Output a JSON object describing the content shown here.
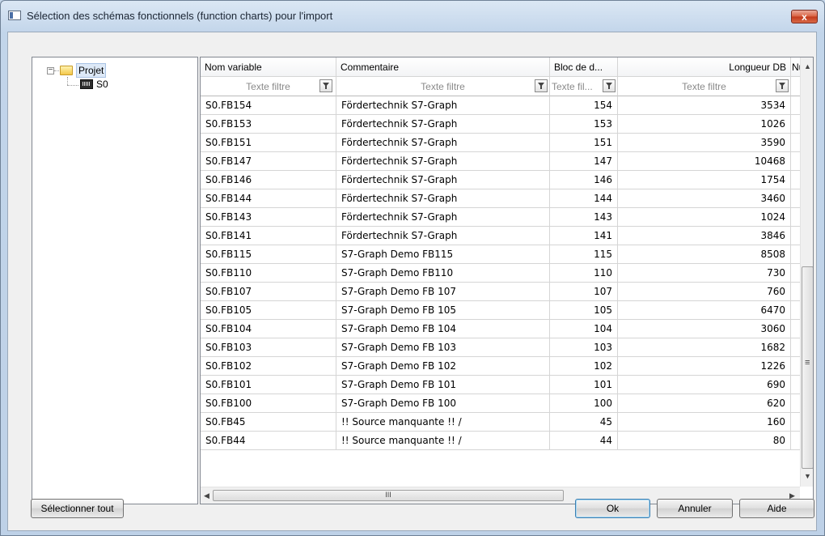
{
  "window": {
    "title": "Sélection des schémas fonctionnels (function charts) pour l'import",
    "close_label": "x"
  },
  "tree": {
    "root_label": "Projet",
    "expander": "−",
    "child_label": "S0"
  },
  "grid": {
    "columns": [
      {
        "label": "Nom variable"
      },
      {
        "label": "Commentaire"
      },
      {
        "label": "Bloc de d..."
      },
      {
        "label": "Longueur DB"
      },
      {
        "label": "Nu"
      }
    ],
    "filters": [
      "Texte filtre",
      "Texte filtre",
      "Texte fil...",
      "Texte filtre"
    ],
    "rows": [
      [
        "S0.FB154",
        "Fördertechnik S7-Graph",
        "154",
        "3534"
      ],
      [
        "S0.FB153",
        "Fördertechnik S7-Graph",
        "153",
        "1026"
      ],
      [
        "S0.FB151",
        "Fördertechnik S7-Graph",
        "151",
        "3590"
      ],
      [
        "S0.FB147",
        "Fördertechnik S7-Graph",
        "147",
        "10468"
      ],
      [
        "S0.FB146",
        "Fördertechnik S7-Graph",
        "146",
        "1754"
      ],
      [
        "S0.FB144",
        "Fördertechnik S7-Graph",
        "144",
        "3460"
      ],
      [
        "S0.FB143",
        "Fördertechnik S7-Graph",
        "143",
        "1024"
      ],
      [
        "S0.FB141",
        "Fördertechnik S7-Graph",
        "141",
        "3846"
      ],
      [
        "S0.FB115",
        "S7-Graph Demo FB115",
        "115",
        "8508"
      ],
      [
        "S0.FB110",
        "S7-Graph Demo FB110",
        "110",
        "730"
      ],
      [
        "S0.FB107",
        "S7-Graph Demo FB 107",
        "107",
        "760"
      ],
      [
        "S0.FB105",
        "S7-Graph Demo FB 105",
        "105",
        "6470"
      ],
      [
        "S0.FB104",
        "S7-Graph Demo FB 104",
        "104",
        "3060"
      ],
      [
        "S0.FB103",
        "S7-Graph Demo FB 103",
        "103",
        "1682"
      ],
      [
        "S0.FB102",
        "S7-Graph Demo FB 102",
        "102",
        "1226"
      ],
      [
        "S0.FB101",
        "S7-Graph Demo FB 101",
        "101",
        "690"
      ],
      [
        "S0.FB100",
        "S7-Graph Demo FB 100",
        "100",
        "620"
      ],
      [
        "S0.FB45",
        "!! Source manquante !! /",
        "45",
        "160"
      ],
      [
        "S0.FB44",
        "!! Source manquante !! /",
        "44",
        "80"
      ]
    ],
    "scroll_up": "▲",
    "scroll_down": "▼",
    "scroll_grip": "≡",
    "scroll_left": "◀",
    "scroll_right": "▶",
    "hgrip": "III"
  },
  "buttons": {
    "select_all": "Sélectionner tout",
    "ok": "Ok",
    "cancel": "Annuler",
    "help": "Aide"
  },
  "colors": {
    "window_frame": "#c6d7ea",
    "close_red": "#c2391b",
    "default_button_border": "#3c7fb1"
  }
}
